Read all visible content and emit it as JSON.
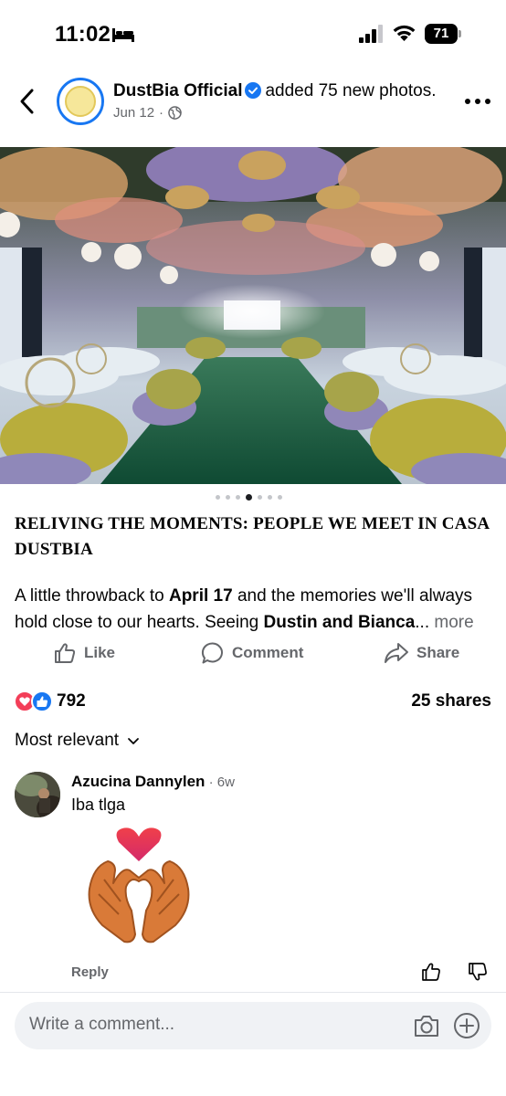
{
  "status_bar": {
    "time": "11:02",
    "battery": "71",
    "icons": [
      "bed-icon",
      "signal-icon",
      "wifi-icon",
      "battery-icon"
    ]
  },
  "post": {
    "page_name": "DustBia Official",
    "action_text": "added 75 new photos.",
    "date": "Jun 12",
    "meta_separator": "·",
    "photo_alt": "",
    "carousel": {
      "total": 7,
      "active_index": 3
    },
    "caption_title": "RELIVING THE MOMENTS: PEOPLE WE MEET IN CASA DUSTBIA",
    "caption": {
      "part1": "A little throwback to ",
      "bold1": "April 17",
      "part2": " and the memories we'll always hold close to our hearts. Seeing ",
      "bold2": "Dustin and Bianca",
      "ellipsis": "...",
      "more": " more"
    }
  },
  "actions": {
    "like": "Like",
    "comment": "Comment",
    "share": "Share"
  },
  "engagement": {
    "reaction_count": "792",
    "shares": "25 shares",
    "reaction_icons": [
      "love-reaction-icon",
      "like-reaction-icon"
    ]
  },
  "comments_section": {
    "sort_label": "Most relevant",
    "comments": [
      {
        "author": "Azucina Dannylen",
        "age": "6w",
        "text": "Iba tlga",
        "sticker": "heart-hands-sticker",
        "reply_label": "Reply"
      }
    ]
  },
  "composer": {
    "placeholder": "Write a comment..."
  },
  "colors": {
    "accent": "#1877f2",
    "secondary_text": "#65676b",
    "love": "#f33e58"
  }
}
